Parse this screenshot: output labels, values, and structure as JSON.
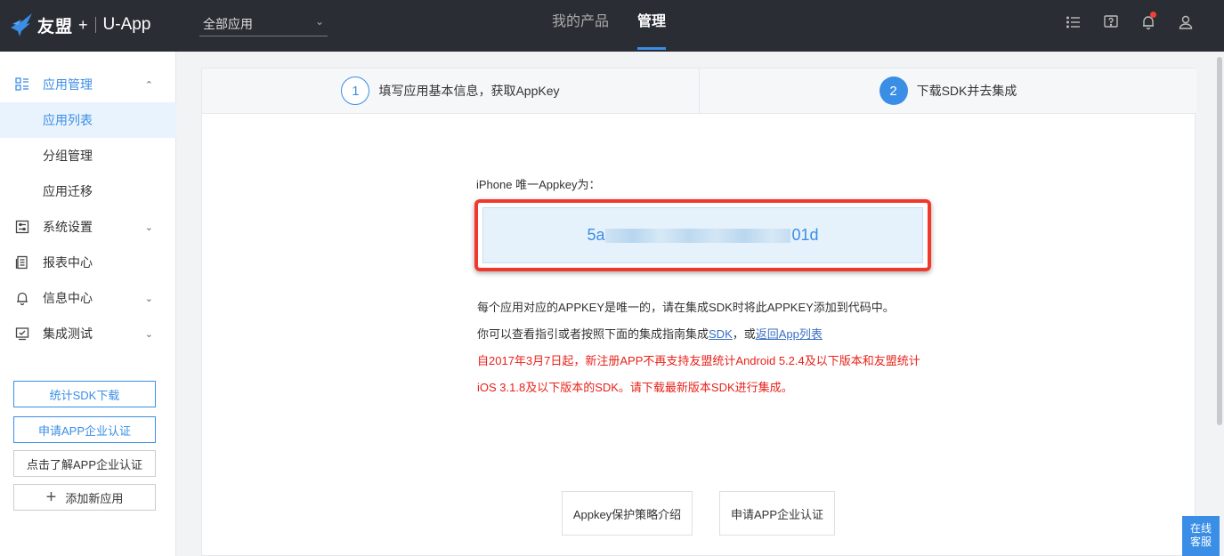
{
  "header": {
    "logo_brand": "友盟",
    "logo_plus": "+",
    "logo_product": "U-App",
    "app_select_value": "全部应用",
    "nav": [
      {
        "label": "我的产品"
      },
      {
        "label": "管理"
      }
    ],
    "icons": [
      "list-icon",
      "help-icon",
      "bell-icon",
      "user-icon"
    ]
  },
  "sidebar": {
    "app_management": "应用管理",
    "sub_items": [
      "应用列表",
      "分组管理",
      "应用迁移"
    ],
    "system_settings": "系统设置",
    "report_center": "报表中心",
    "message_center": "信息中心",
    "integration_test": "集成测试",
    "btn_sdk_download": "统计SDK下载",
    "btn_apply_cert": "申请APP企业认证",
    "btn_learn_cert": "点击了解APP企业认证",
    "btn_add_app": "添加新应用"
  },
  "steps": [
    {
      "num": "1",
      "label": "填写应用基本信息，获取AppKey"
    },
    {
      "num": "2",
      "label": "下载SDK并去集成"
    }
  ],
  "appkey": {
    "label": "iPhone 唯一Appkey为：",
    "prefix": "5a",
    "suffix": "01d"
  },
  "info": {
    "line1": "每个应用对应的APPKEY是唯一的，请在集成SDK时将此APPKEY添加到代码中。",
    "line2_prefix": "你可以查看指引或者按照下面的集成指南集成",
    "line2_link_sdk": "SDK",
    "line2_middle": "，或",
    "line2_link_back": "返回App列表",
    "notice_line1": "自2017年3月7日起，新注册APP不再支持友盟统计Android 5.2.4及以下版本和友盟统计",
    "notice_line2": "iOS 3.1.8及以下版本的SDK。请下载最新版本SDK进行集成。"
  },
  "buttons": {
    "policy": "Appkey保护策略介绍",
    "apply_cert": "申请APP企业认证"
  },
  "service": {
    "line1": "在线",
    "line2": "客服"
  },
  "colors": {
    "accent": "#3a8ee6",
    "topbar": "#2a2d33",
    "highlight_border": "#f0382c",
    "notice_red": "#e8221a"
  }
}
